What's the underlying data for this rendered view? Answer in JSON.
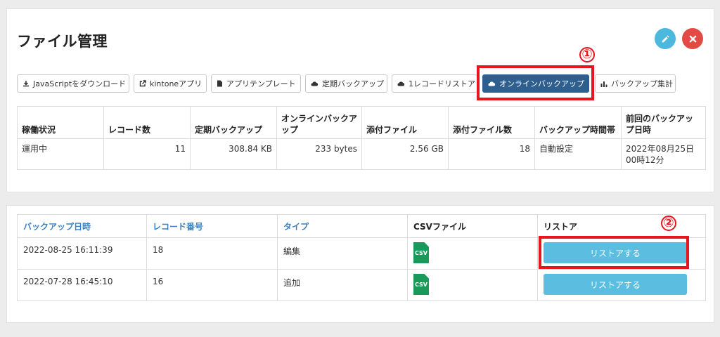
{
  "header": {
    "title": "ファイル管理",
    "edit_icon": "pencil-icon",
    "close_icon": "x-icon"
  },
  "toolbar": {
    "buttons": [
      {
        "label": "JavaScriptをダウンロード",
        "icon": "download-icon"
      },
      {
        "label": "kintoneアプリ",
        "icon": "external-link-icon"
      },
      {
        "label": "アプリテンプレート",
        "icon": "file-icon"
      },
      {
        "label": "定期バックアップ",
        "icon": "cloud-icon"
      },
      {
        "label": "1レコードリストア",
        "icon": "cloud-icon"
      },
      {
        "label": "オンラインバックアップ",
        "icon": "cloud-icon",
        "active": true
      },
      {
        "label": "バックアップ集計",
        "icon": "bar-chart-icon"
      }
    ]
  },
  "annotations": {
    "marker1": "①",
    "marker2": "②",
    "color": "#e8141e"
  },
  "stats": {
    "headers": [
      "稼働状況",
      "レコード数",
      "定期バックアップ",
      "オンラインバックアップ",
      "添付ファイル",
      "添付ファイル数",
      "バックアップ時間帯",
      "前回のバックアップ日時"
    ],
    "values": [
      "運用中",
      "11",
      "308.84 KB",
      "233 bytes",
      "2.56 GB",
      "18",
      "自動設定",
      "2022年08月25日00時12分"
    ]
  },
  "backups": {
    "headers": [
      "バックアップ日時",
      "レコード番号",
      "タイプ",
      "CSVファイル",
      "リストア"
    ],
    "rows": [
      {
        "datetime": "2022-08-25 16:11:39",
        "record": "18",
        "type": "編集",
        "csv": "CSV",
        "restore": "リストアする"
      },
      {
        "datetime": "2022-07-28 16:45:10",
        "record": "16",
        "type": "追加",
        "csv": "CSV",
        "restore": "リストアする"
      }
    ]
  },
  "colors": {
    "active_button": "#2e5f8e",
    "restore_button": "#5bbde0",
    "link": "#3a82c4",
    "csv_icon": "#1a9a5a",
    "edit_button": "#4cb8dd",
    "close_button": "#e14b43"
  }
}
